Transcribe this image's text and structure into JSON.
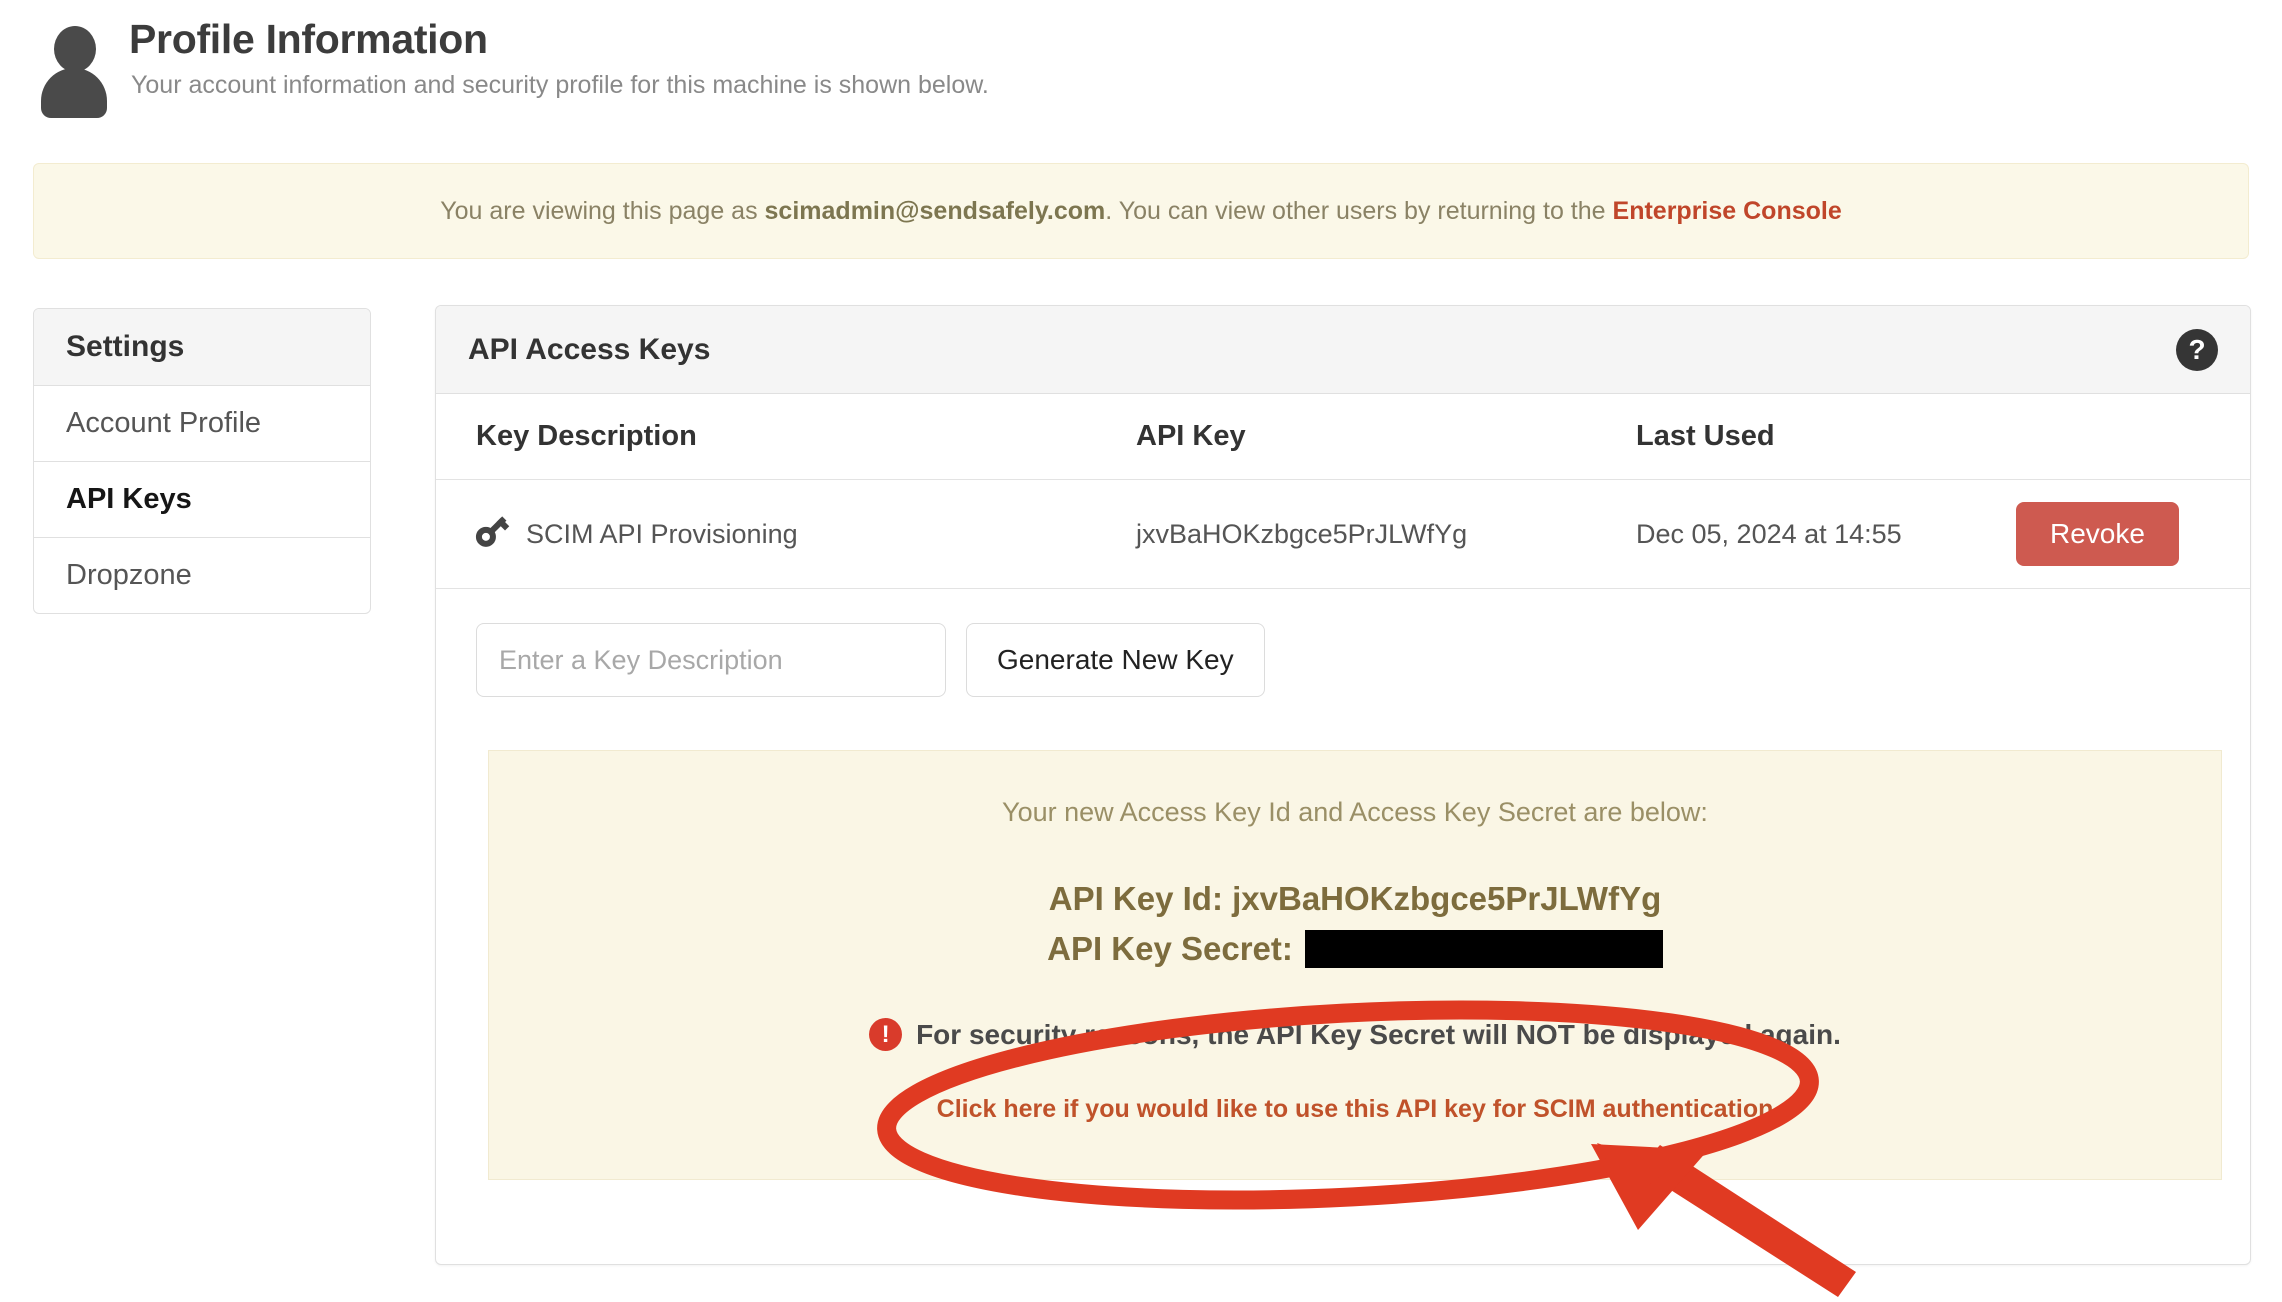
{
  "header": {
    "title": "Profile Information",
    "subtitle": "Your account information and security profile for this machine is shown below.",
    "avatar_icon": "user-avatar-icon"
  },
  "impersonation_banner": {
    "prefix": "You are viewing this page as ",
    "email": "scimadmin@sendsafely.com",
    "middle": ". You can view other users by returning to the ",
    "link_label": "Enterprise Console",
    "background_color": "#fbf8e8",
    "link_color": "#c0462a"
  },
  "sidebar": {
    "heading": "Settings",
    "items": [
      {
        "label": "Account Profile",
        "active": false
      },
      {
        "label": "API Keys",
        "active": true
      },
      {
        "label": "Dropzone",
        "active": false
      }
    ]
  },
  "main": {
    "card_title": "API Access Keys",
    "help_icon": "question-mark-circle-icon",
    "table": {
      "columns": [
        "Key Description",
        "API Key",
        "Last Used",
        ""
      ],
      "rows": [
        {
          "icon": "key-icon",
          "description": "SCIM API Provisioning",
          "api_key": "jxvBaHOKzbgce5PrJLWfYg",
          "last_used": "Dec 05, 2024 at 14:55",
          "action_label": "Revoke"
        }
      ]
    },
    "generate": {
      "input_value": "",
      "input_placeholder": "Enter a Key Description",
      "button_label": "Generate New Key"
    },
    "new_key_alert": {
      "intro": "Your new Access Key Id and Access Key Secret are below:",
      "key_id_label": "API Key Id: jxvBaHOKzbgce5PrJLWfYg",
      "secret_label": "API Key Secret:",
      "secret_value": "",
      "secret_redacted": true,
      "warning_icon": "exclamation-circle-icon",
      "warning_text": "For security reasons, the API Key Secret will NOT be displayed again.",
      "scim_link_label": "Click here if you would like to use this API key for SCIM authentication",
      "background_color": "#faf6e5"
    }
  },
  "annotation": {
    "color": "#e03a22",
    "shapes": [
      "highlight-ellipse",
      "pointer-arrow"
    ],
    "target": "Click here if you would like to use this API key for SCIM authentication"
  }
}
